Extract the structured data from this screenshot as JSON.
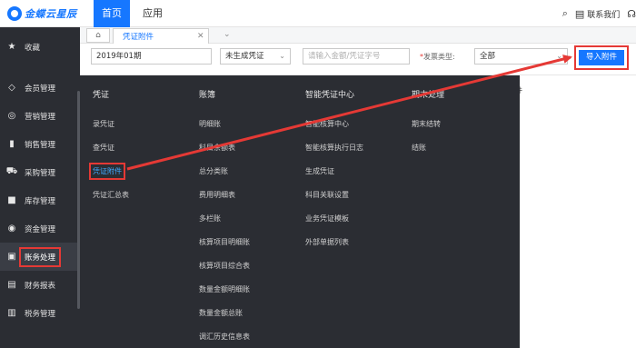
{
  "header": {
    "logo_text": "金蝶云星辰",
    "nav_home": "首页",
    "nav_app": "应用",
    "search_icon": "search-icon",
    "contact_label": "联系我们"
  },
  "sidebar": {
    "items": [
      {
        "label": "收藏",
        "icon": "star-icon"
      },
      {
        "label": "会员管理",
        "icon": "diamond-icon"
      },
      {
        "label": "营销管理",
        "icon": "target-icon"
      },
      {
        "label": "销售管理",
        "icon": "bar-chart-icon"
      },
      {
        "label": "采购管理",
        "icon": "cart-icon"
      },
      {
        "label": "库存管理",
        "icon": "box-icon"
      },
      {
        "label": "资金管理",
        "icon": "money-icon"
      },
      {
        "label": "账务处理",
        "icon": "ledger-icon"
      },
      {
        "label": "财务报表",
        "icon": "report-icon"
      },
      {
        "label": "税务管理",
        "icon": "tax-icon"
      }
    ]
  },
  "tabs": {
    "doc_tab_label": "凭证附件"
  },
  "filters": {
    "date_value": "2019年01期",
    "status_value": "未生成凭证",
    "search_placeholder": "请输入金额/凭证字号",
    "invoice_type_label": "发票类型:",
    "invoice_type_value": "全部",
    "import_button": "导入附件",
    "toolbar_fragment": "件"
  },
  "megamenu": {
    "columns": [
      {
        "title": "凭证",
        "items": [
          "录凭证",
          "查凭证",
          "凭证附件",
          "凭证汇总表"
        ]
      },
      {
        "title": "账簿",
        "items": [
          "明细账",
          "科目余额表",
          "总分类账",
          "费用明细表",
          "多栏账",
          "核算项目明细账",
          "核算项目综合表",
          "数量金额明细账",
          "数量金额总账",
          "调汇历史信息表"
        ]
      },
      {
        "title": "智能凭证中心",
        "items": [
          "智能核算中心",
          "智能核算执行日志",
          "生成凭证",
          "科目关联设置",
          "业务凭证模板",
          "外部单据列表"
        ]
      },
      {
        "title": "期末处理",
        "items": [
          "期末结转",
          "结账"
        ]
      }
    ]
  },
  "colors": {
    "brand": "#1677ff",
    "sidebar_bg": "#2b2d33",
    "annotation_red": "#e53935"
  }
}
